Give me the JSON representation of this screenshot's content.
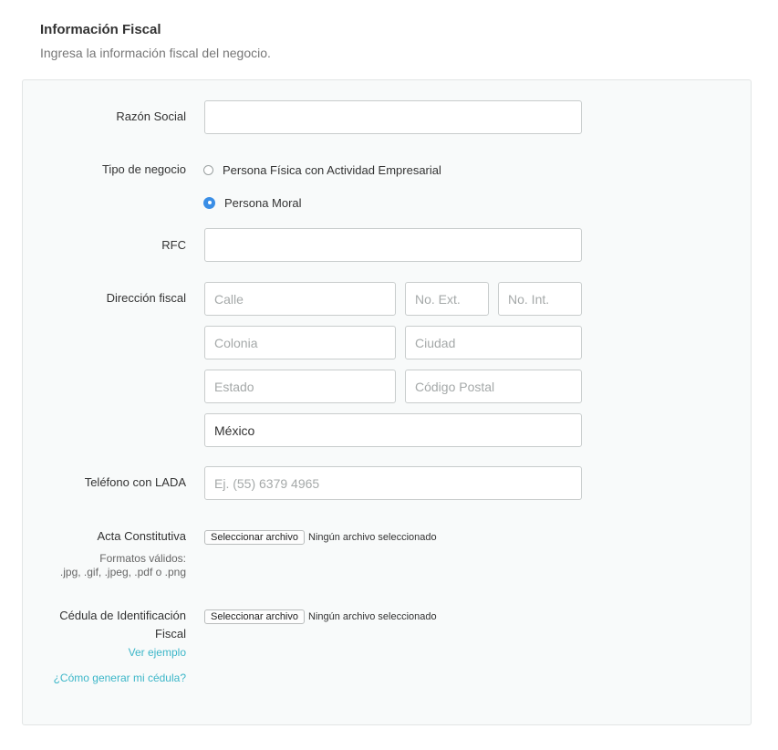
{
  "header": {
    "title": "Información Fiscal",
    "subtitle": "Ingresa la información fiscal del negocio."
  },
  "form": {
    "razon_social": {
      "label": "Razón Social",
      "value": "",
      "placeholder": ""
    },
    "tipo_negocio": {
      "label": "Tipo de negocio",
      "options": [
        {
          "label": "Persona Física con Actividad Empresarial",
          "checked": false
        },
        {
          "label": "Persona Moral",
          "checked": true
        }
      ]
    },
    "rfc": {
      "label": "RFC",
      "value": "",
      "placeholder": ""
    },
    "direccion": {
      "label": "Dirección fiscal",
      "calle": {
        "placeholder": "Calle",
        "value": ""
      },
      "no_ext": {
        "placeholder": "No. Ext.",
        "value": ""
      },
      "no_int": {
        "placeholder": "No. Int.",
        "value": ""
      },
      "colonia": {
        "placeholder": "Colonia",
        "value": ""
      },
      "ciudad": {
        "placeholder": "Ciudad",
        "value": ""
      },
      "estado": {
        "placeholder": "Estado",
        "value": ""
      },
      "codigo_postal": {
        "placeholder": "Código Postal",
        "value": ""
      },
      "pais": {
        "value": "México"
      }
    },
    "telefono": {
      "label": "Teléfono con LADA",
      "placeholder": "Ej. (55) 6379 4965",
      "value": ""
    },
    "acta": {
      "label": "Acta Constitutiva",
      "hint_line1": "Formatos válidos:",
      "hint_line2": ".jpg, .gif, .jpeg, .pdf o .png",
      "button": "Seleccionar archivo",
      "status": "Ningún archivo seleccionado"
    },
    "cedula": {
      "label_line1": "Cédula de Identificación",
      "label_line2": "Fiscal",
      "link_example": "Ver ejemplo",
      "link_howto": "¿Cómo generar mi cédula?",
      "button": "Seleccionar archivo",
      "status": "Ningún archivo seleccionado"
    }
  },
  "colors": {
    "accent": "#3a8ee6",
    "link": "#3cb6c8",
    "panel_bg": "#f8fafa"
  }
}
